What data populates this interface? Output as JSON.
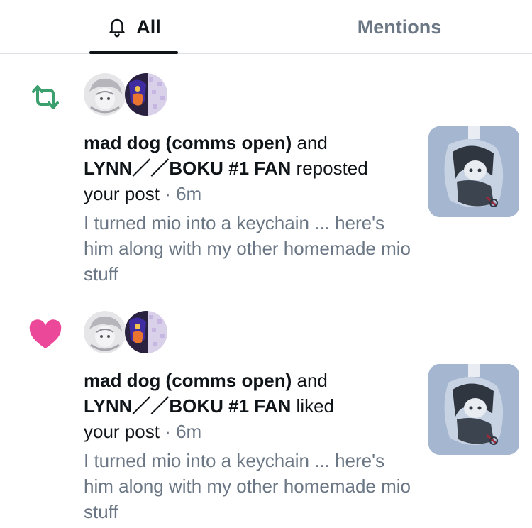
{
  "tabs": {
    "all_label": "All",
    "mentions_label": "Mentions"
  },
  "colors": {
    "repost_green": "#3ba06e",
    "like_pink": "#ec4899",
    "muted_text": "#6b7785"
  },
  "notifications": [
    {
      "type": "repost",
      "icon": "repost-icon",
      "user1": "mad dog (comms open)",
      "connector": "and",
      "user2": "LYNN／／BOKU #1 FAN",
      "action": "reposted",
      "object": "your post",
      "separator": "·",
      "time": "6m",
      "preview": "I turned mio into a keychain ... here's him along with my other homemade mio stuff"
    },
    {
      "type": "like",
      "icon": "heart-icon",
      "user1": "mad dog (comms open)",
      "connector": "and",
      "user2": "LYNN／／BOKU #1 FAN",
      "action": "liked",
      "object": "your post",
      "separator": "·",
      "time": "6m",
      "preview": "I turned mio into a keychain ... here's him along with my other homemade mio stuff"
    }
  ]
}
